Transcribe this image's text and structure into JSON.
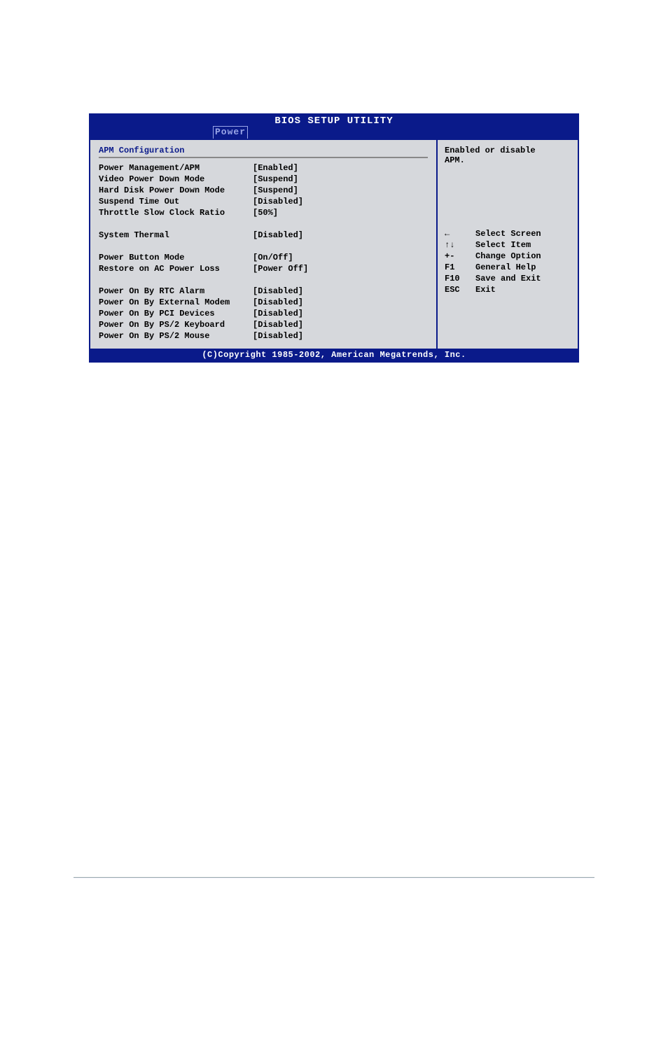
{
  "title": "BIOS SETUP UTILITY",
  "tab": "Power",
  "section_header": "APM Configuration",
  "settings_group1": [
    {
      "label": "Power Management/APM",
      "value": "[Enabled]"
    },
    {
      "label": "Video Power Down Mode",
      "value": "[Suspend]"
    },
    {
      "label": "Hard Disk Power Down Mode",
      "value": "[Suspend]"
    },
    {
      "label": "Suspend Time Out",
      "value": "[Disabled]"
    },
    {
      "label": "Throttle Slow Clock Ratio",
      "value": "[50%]"
    }
  ],
  "settings_group2": [
    {
      "label": "System Thermal",
      "value": "[Disabled]"
    }
  ],
  "settings_group3": [
    {
      "label": "Power Button Mode",
      "value": "[On/Off]"
    },
    {
      "label": "Restore on AC Power Loss",
      "value": "[Power Off]"
    }
  ],
  "settings_group4": [
    {
      "label": "Power On By RTC Alarm",
      "value": "[Disabled]"
    },
    {
      "label": "Power On By External Modem",
      "value": "[Disabled]"
    },
    {
      "label": "Power On By PCI Devices",
      "value": "[Disabled]"
    },
    {
      "label": "Power On By PS/2 Keyboard",
      "value": "[Disabled]"
    },
    {
      "label": "Power On By PS/2 Mouse",
      "value": "[Disabled]"
    }
  ],
  "help_line1": "Enabled or disable",
  "help_line2": "APM.",
  "nav": [
    {
      "key_icon": "←",
      "desc": "Select Screen"
    },
    {
      "key_icon": "↑↓",
      "desc": "Select Item"
    },
    {
      "key": "+-",
      "desc": "Change Option"
    },
    {
      "key": "F1",
      "desc": "General Help"
    },
    {
      "key": "F10",
      "desc": "Save and Exit"
    },
    {
      "key": "ESC",
      "desc": "Exit"
    }
  ],
  "footer": "(C)Copyright 1985-2002, American Megatrends, Inc."
}
